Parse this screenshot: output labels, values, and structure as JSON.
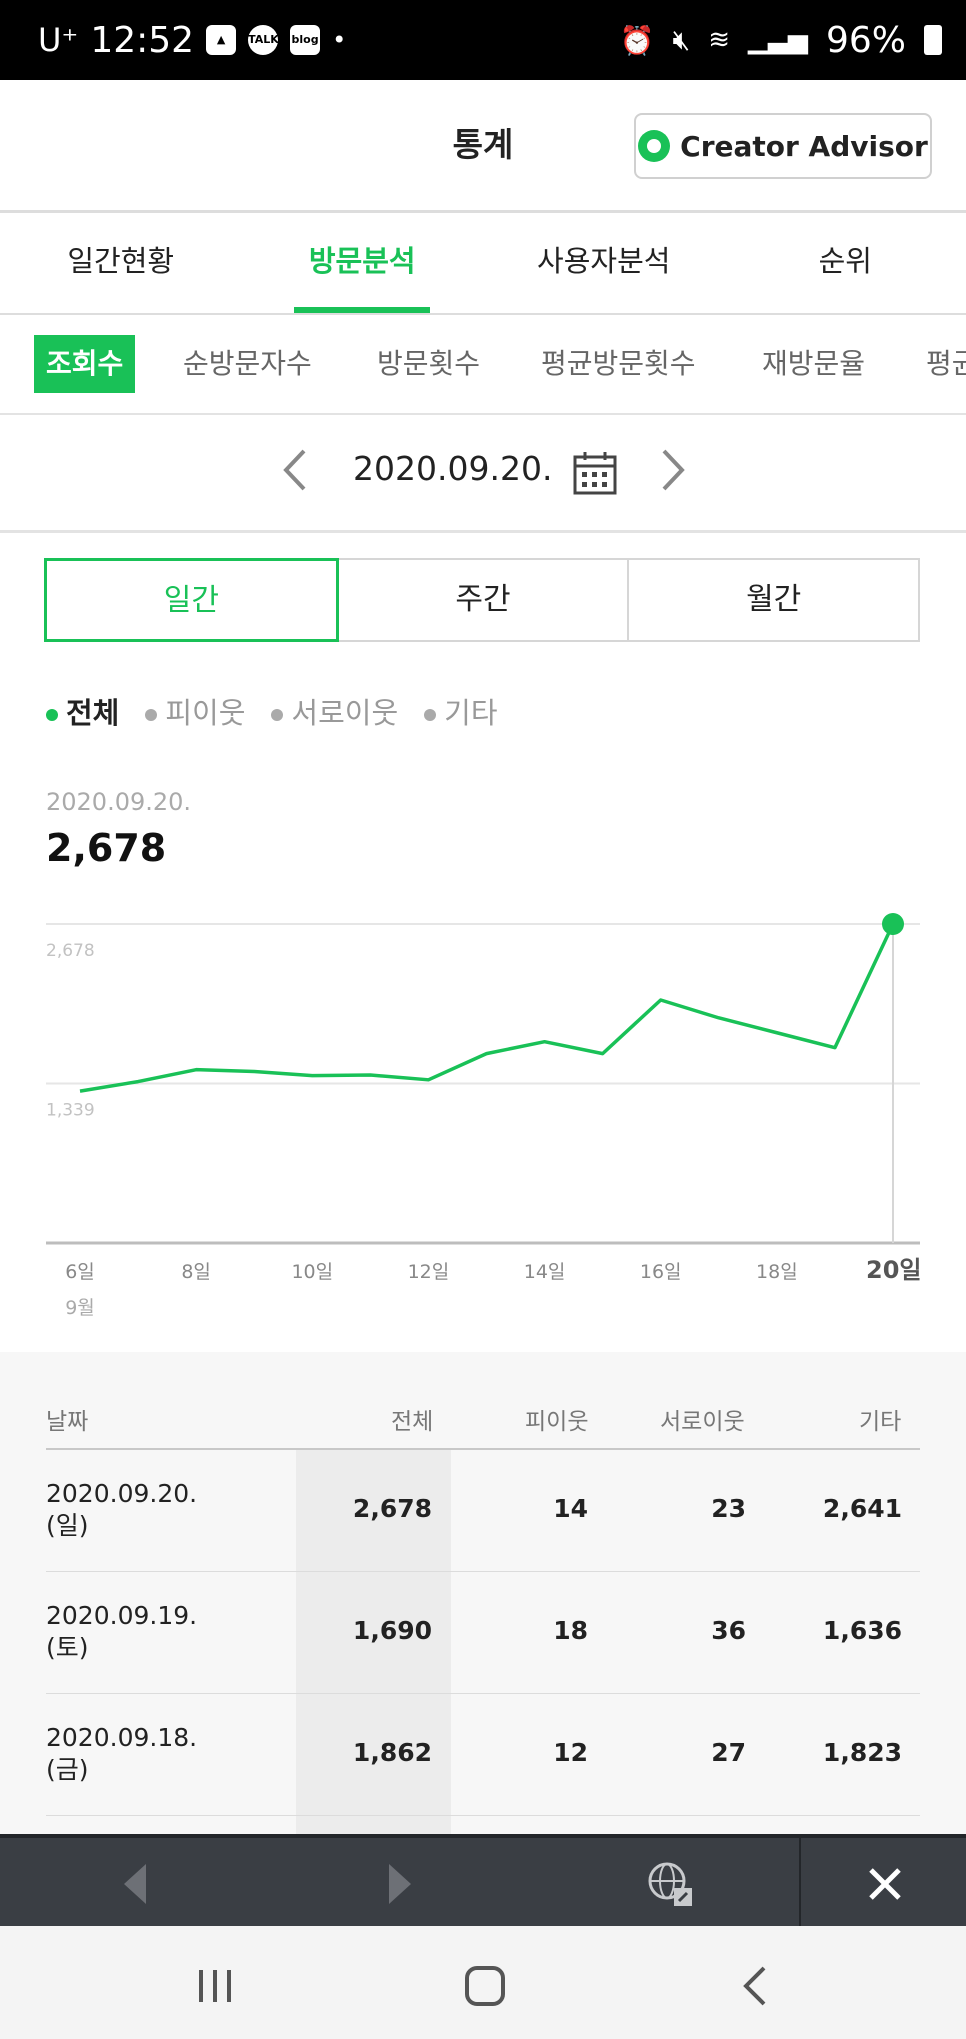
{
  "status_bar": {
    "carrier": "U⁺",
    "time": "12:52",
    "talk_label": "TALK",
    "blog_label": "blog",
    "battery": "96%"
  },
  "header": {
    "title": "통계",
    "creator_advisor_label": "Creator Advisor"
  },
  "main_tabs": [
    "일간현황",
    "방문분석",
    "사용자분석",
    "순위"
  ],
  "active_main_tab": "방문분석",
  "sub_tabs": [
    "조회수",
    "순방문자수",
    "방문횟수",
    "평균방문횟수",
    "재방문율",
    "평균"
  ],
  "date_nav": {
    "date": "2020.09.20."
  },
  "period_tabs": [
    "일간",
    "주간",
    "월간"
  ],
  "legend": [
    "전체",
    "피이웃",
    "서로이웃",
    "기타"
  ],
  "selected": {
    "date": "2020.09.20.",
    "value": "2,678"
  },
  "chart_data": {
    "type": "line",
    "x": [
      "6일",
      "7일",
      "8일",
      "9일",
      "10일",
      "11일",
      "12일",
      "13일",
      "14일",
      "15일",
      "16일",
      "17일",
      "18일",
      "19일",
      "20일"
    ],
    "xtick_labels": [
      "6일",
      "8일",
      "10일",
      "12일",
      "14일",
      "16일",
      "18일",
      "20일"
    ],
    "xtick_sublabel": "9월",
    "series": [
      {
        "name": "전체",
        "values": [
          1275,
          1355,
          1455,
          1440,
          1405,
          1410,
          1370,
          1590,
          1690,
          1590,
          2040,
          1890,
          1765,
          1640,
          2678
        ]
      }
    ],
    "ytick_labels": [
      "2,678",
      "1,339"
    ],
    "ylim": [
      0,
      2678
    ],
    "color": "#19c157",
    "highlight_last": true
  },
  "table": {
    "headers": [
      "날짜",
      "전체",
      "피이웃",
      "서로이웃",
      "기타"
    ],
    "rows": [
      {
        "date": "2020.09.20.",
        "day": "(일)",
        "total": "2,678",
        "neighbor": "14",
        "mutual": "23",
        "other": "2,641"
      },
      {
        "date": "2020.09.19.",
        "day": "(토)",
        "total": "1,690",
        "neighbor": "18",
        "mutual": "36",
        "other": "1,636"
      },
      {
        "date": "2020.09.18.",
        "day": "(금)",
        "total": "1,862",
        "neighbor": "12",
        "mutual": "27",
        "other": "1,823"
      }
    ]
  }
}
